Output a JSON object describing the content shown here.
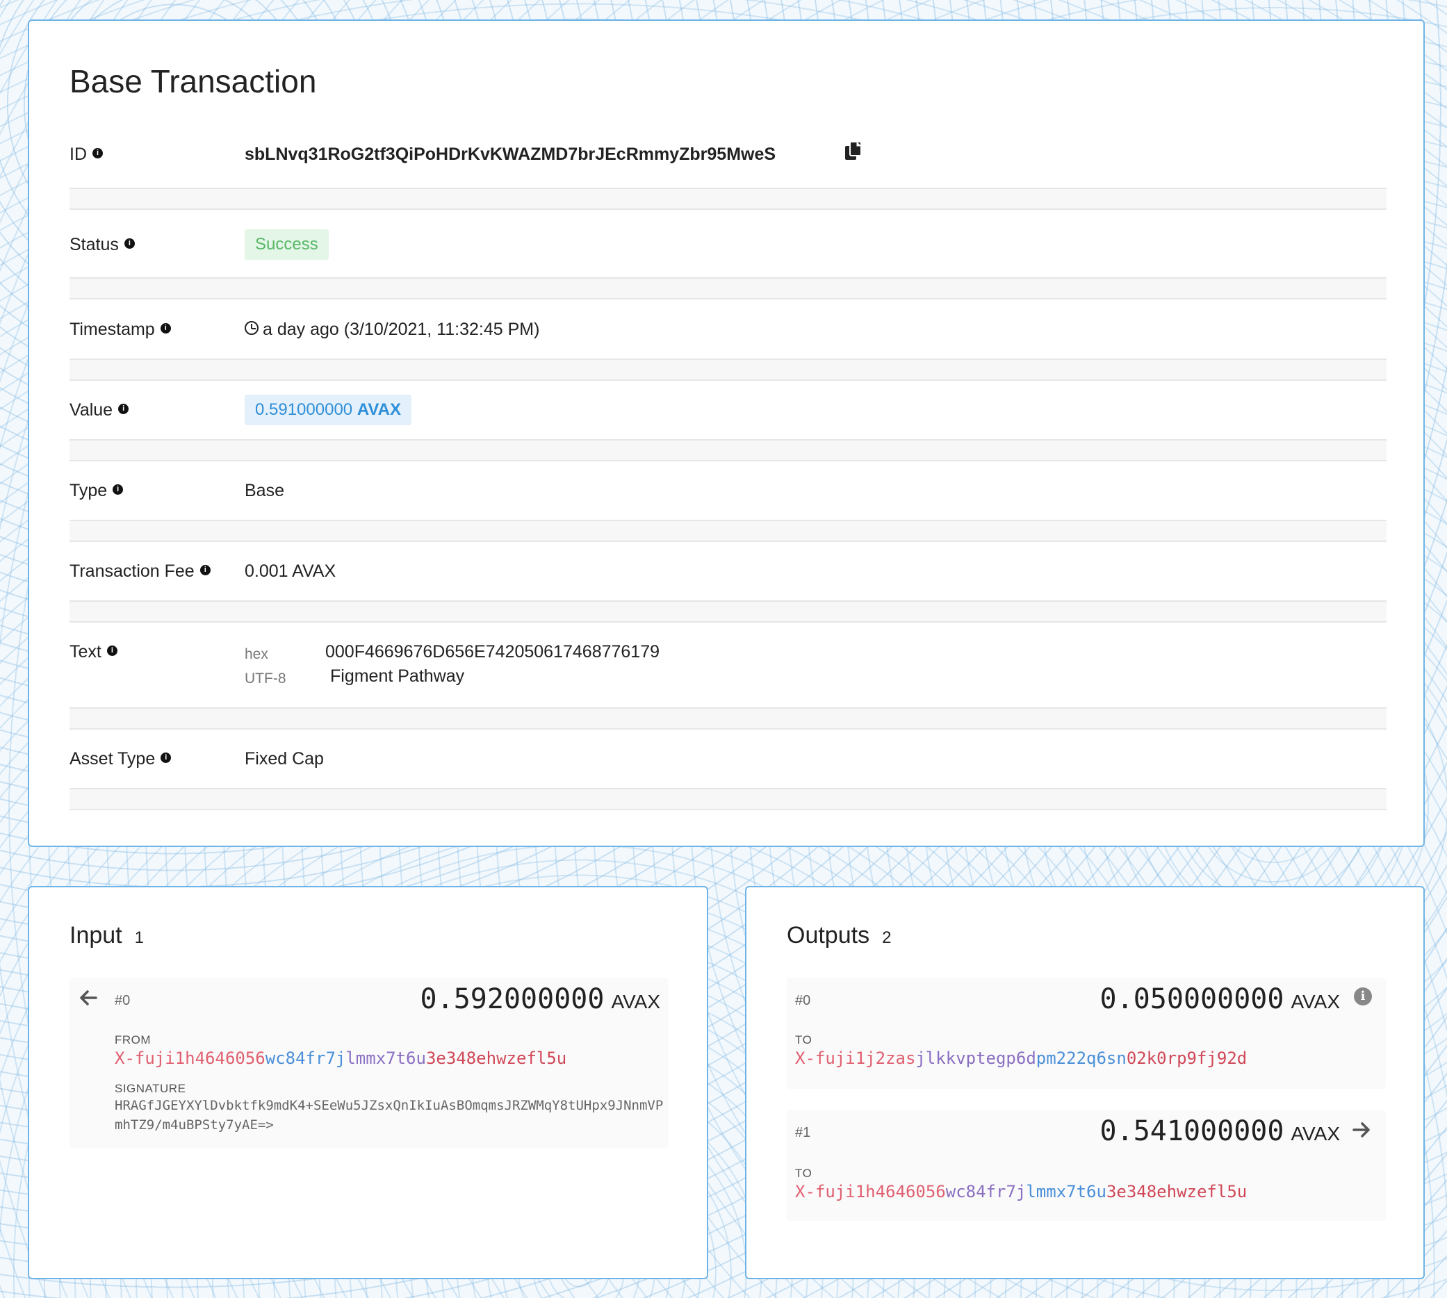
{
  "main": {
    "title": "Base Transaction",
    "id_label": "ID",
    "id_value": "sbLNvq31RoG2tf3QiPoHDrKvKWAZMD7brJEcRmmyZbr95MweS",
    "status_label": "Status",
    "status_value": "Success",
    "timestamp_label": "Timestamp",
    "timestamp_value": "a day ago (3/10/2021, 11:32:45 PM)",
    "value_label": "Value",
    "value_amount": "0.591000000",
    "value_unit": "AVAX",
    "type_label": "Type",
    "type_value": "Base",
    "fee_label": "Transaction Fee",
    "fee_value": "0.001 AVAX",
    "text_label": "Text",
    "text_hex_key": "hex",
    "text_hex_value": "000F4669676D656E742050617468776179",
    "text_utf8_key": "UTF-8",
    "text_utf8_value": "Figment Pathway",
    "asset_type_label": "Asset Type",
    "asset_type_value": "Fixed Cap"
  },
  "input": {
    "title": "Input",
    "count": "1",
    "items": [
      {
        "index": "#0",
        "amount": "0.592000000",
        "unit": "AVAX",
        "from_label": "FROM",
        "address_parts": [
          "X-fuji1h4646056",
          "wc84fr7j",
          "lmmx7t6u",
          "3e348ehwzefl5u"
        ],
        "signature_label": "SIGNATURE",
        "signature": "HRAGfJGEYXYlDvbktfk9mdK4+SEeWu5JZsxQnIkIuAsBOmqmsJRZWMqY8tUHpx9JNnmVPmhTZ9/m4uBPSty7yAE=>"
      }
    ]
  },
  "outputs": {
    "title": "Outputs",
    "count": "2",
    "items": [
      {
        "index": "#0",
        "amount": "0.050000000",
        "unit": "AVAX",
        "to_label": "TO",
        "address_parts": [
          "X-fuji1j2zas",
          "jlkkvptegp6d",
          "pm222q6sn",
          "02k0rp9fj92d"
        ]
      },
      {
        "index": "#1",
        "amount": "0.541000000",
        "unit": "AVAX",
        "to_label": "TO",
        "address_parts": [
          "X-fuji1h4646056",
          "wc84fr7j",
          "lmmx7t6u",
          "3e348ehwzefl5u"
        ]
      }
    ]
  },
  "colors": {
    "card_border": "#6fb4e6",
    "success_bg": "#e4f6e7",
    "success_text": "#58b868",
    "value_bg": "#e4f0fb",
    "value_text": "#2f8fd8"
  }
}
